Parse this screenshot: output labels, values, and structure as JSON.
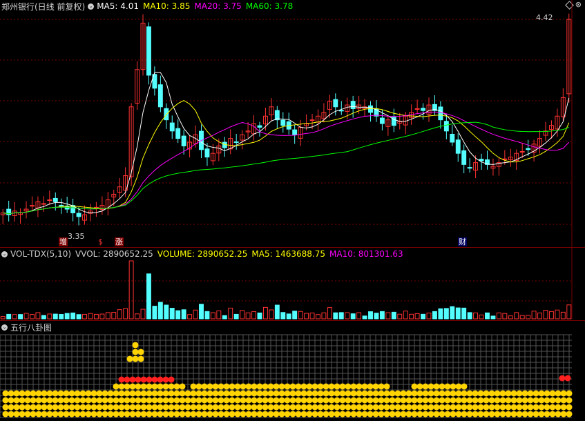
{
  "main_panel": {
    "title": "郑州银行(日线 前复权)",
    "ma5_label": "MA5: 4.01",
    "ma10_label": "MA10: 3.85",
    "ma20_label": "MA20: 3.75",
    "ma60_label": "MA60: 3.78",
    "high_label": "4.42",
    "low_label": "3.35",
    "markers": [
      "增",
      "$",
      "涨",
      "财"
    ],
    "colors": {
      "ma5": "#ffffff",
      "ma10": "#ffff00",
      "ma20": "#ff00ff",
      "ma60": "#00ff00",
      "up": "#ff3232",
      "down": "#54ffff"
    }
  },
  "vol_panel": {
    "indicator": "VOL-TDX(5,10)",
    "vvol_label": "VVOL: 2890652.25",
    "volume_label": "VOLUME: 2890652.25",
    "ma5_label": "MA5: 1463688.75",
    "ma10_label": "MA10: 801301.63"
  },
  "bagua_panel": {
    "title": "五行八卦图"
  },
  "chart_data": {
    "type": "candlestick",
    "count": 98,
    "close_seed": [
      3.38,
      3.37,
      3.39,
      3.38,
      3.4,
      3.42,
      3.44,
      3.43,
      3.45,
      3.44,
      3.42,
      3.4,
      3.38,
      3.36,
      3.37,
      3.39,
      3.41,
      3.42,
      3.45,
      3.48,
      3.52,
      3.58,
      3.95,
      4.15,
      4.4,
      4.12,
      4.05,
      3.95,
      3.88,
      3.82,
      3.78,
      3.74,
      3.76,
      3.8,
      3.72,
      3.68,
      3.7,
      3.74,
      3.73,
      3.78,
      3.76,
      3.8,
      3.82,
      3.86,
      3.84,
      3.9,
      3.95,
      3.88,
      3.85,
      3.83,
      3.8,
      3.84,
      3.86,
      3.88,
      3.9,
      3.92,
      3.98,
      3.95,
      3.93,
      3.96,
      3.94,
      3.96,
      3.95,
      3.92,
      3.9,
      3.86,
      3.88,
      3.85,
      3.87,
      3.9,
      3.92,
      3.94,
      3.93,
      3.96,
      3.93,
      3.88,
      3.82,
      3.76,
      3.7,
      3.64,
      3.62,
      3.65,
      3.66,
      3.64,
      3.63,
      3.65,
      3.67,
      3.68,
      3.7,
      3.71,
      3.72,
      3.75,
      3.78,
      3.82,
      3.85,
      3.9,
      4.0,
      4.42
    ],
    "ylim": [
      3.3,
      4.45
    ]
  }
}
